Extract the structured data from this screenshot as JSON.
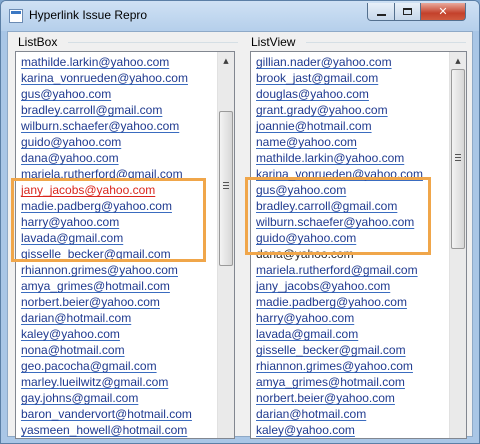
{
  "window": {
    "title": "Hyperlink Issue Repro",
    "minimize_icon": "minimize-icon",
    "maximize_icon": "maximize-icon",
    "close_icon": "close-icon"
  },
  "listbox": {
    "label": "ListBox",
    "items": [
      "mathilde.larkin@yahoo.com",
      "karina_vonrueden@yahoo.com",
      "gus@yahoo.com",
      "bradley.carroll@gmail.com",
      "wilburn.schaefer@yahoo.com",
      "guido@yahoo.com",
      "dana@yahoo.com",
      "mariela.rutherford@gmail.com",
      "jany_jacobs@yahoo.com",
      "madie.padberg@yahoo.com",
      "harry@yahoo.com",
      "lavada@gmail.com",
      "gisselle_becker@gmail.com",
      "rhiannon.grimes@yahoo.com",
      "amya_grimes@hotmail.com",
      "norbert.beier@yahoo.com",
      "darian@hotmail.com",
      "kaley@yahoo.com",
      "nona@hotmail.com",
      "geo.pacocha@gmail.com",
      "marley.lueilwitz@gmail.com",
      "gay.johns@gmail.com",
      "baron_vandervort@hotmail.com",
      "yasmeen_howell@hotmail.com"
    ],
    "red_item_index": 8
  },
  "listview": {
    "label": "ListView",
    "items": [
      "gillian.nader@yahoo.com",
      "brook_jast@gmail.com",
      "douglas@yahoo.com",
      "grant.grady@yahoo.com",
      "joannie@hotmail.com",
      "name@yahoo.com",
      "mathilde.larkin@yahoo.com",
      "karina_vonrueden@yahoo.com",
      "gus@yahoo.com",
      "bradley.carroll@gmail.com",
      "wilburn.schaefer@yahoo.com",
      "guido@yahoo.com",
      "dana@yahoo.com",
      "mariela.rutherford@gmail.com",
      "jany_jacobs@yahoo.com",
      "madie.padberg@yahoo.com",
      "harry@yahoo.com",
      "lavada@gmail.com",
      "gisselle_becker@gmail.com",
      "rhiannon.grimes@yahoo.com",
      "amya_grimes@hotmail.com",
      "norbert.beier@yahoo.com",
      "darian@hotmail.com",
      "kaley@yahoo.com"
    ],
    "plain_item_index": 12
  },
  "colors": {
    "link": "#1f3a8f",
    "visited_red": "#d9251d",
    "highlight_box": "#f0a64a"
  }
}
